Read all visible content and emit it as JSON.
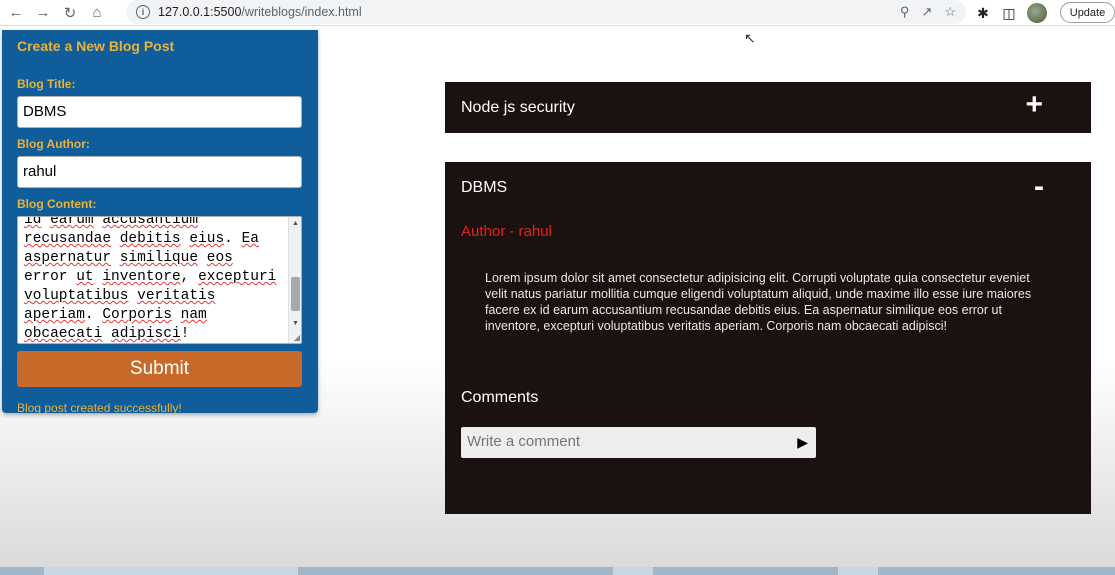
{
  "browser": {
    "back_icon": "arrow-left-icon",
    "forward_icon": "arrow-right-icon",
    "reload_icon": "reload-icon",
    "home_icon": "home-icon",
    "url_host": "127.0.0.1:5500",
    "url_path": "/writeblogs/index.html",
    "update_label": "Update"
  },
  "form": {
    "title": "Create a New Blog Post",
    "title_label": "Blog Title:",
    "title_value": "DBMS",
    "author_label": "Blog Author:",
    "author_value": "rahul",
    "content_label": "Blog Content:",
    "content_lines": [
      "id earum accusantium",
      "recusandae debitis eius. Ea",
      "aspernatur similique eos",
      "error ut inventore, excepturi",
      "voluptatibus veritatis",
      "aperiam. Corporis nam",
      "obcaecati adipisci!"
    ],
    "submit_label": "Submit",
    "success_message": "Blog post created successfully!"
  },
  "posts": [
    {
      "title": "Node js security",
      "toggle": "+",
      "expanded": false
    },
    {
      "title": "DBMS",
      "toggle": "-",
      "expanded": true,
      "author_line": "Author - rahul",
      "content": "Lorem ipsum dolor sit amet consectetur adipisicing elit. Corrupti voluptate quia consectetur eveniet velit natus pariatur mollitia cumque eligendi voluptatum aliquid, unde maxime illo esse iure maiores facere ex id earum accusantium recusandae debitis eius. Ea aspernatur similique eos error ut inventore, excepturi voluptatibus veritatis aperiam. Corporis nam obcaecati adipisci!",
      "comments_heading": "Comments",
      "comment_placeholder": "Write a comment"
    }
  ],
  "colors": {
    "panel_bg": "#0f5d9b",
    "label_gold": "#e8b33a",
    "submit_bg": "#c8692a",
    "accordion_bg": "#1a1110",
    "author_red": "#e5221f"
  }
}
